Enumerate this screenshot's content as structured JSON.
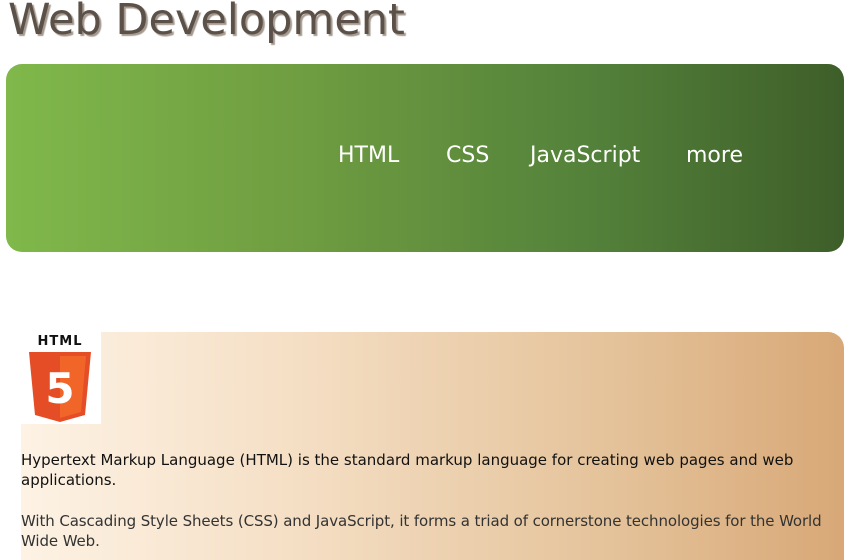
{
  "header": {
    "title": "Web Development"
  },
  "nav": {
    "items": [
      {
        "label": "HTML"
      },
      {
        "label": "CSS"
      },
      {
        "label": "JavaScript"
      },
      {
        "label": "more"
      }
    ],
    "gradient_colors": [
      "#80b84b",
      "#3e5e29"
    ]
  },
  "content": {
    "logo": {
      "text": "HTML",
      "number": "5",
      "icon": "html5-shield-icon",
      "colors": [
        "#e44d26",
        "#f16529",
        "#ebebeb",
        "#ffffff"
      ]
    },
    "paragraphs": [
      "Hypertext Markup Language (HTML) is the standard markup language for creating web pages and web applications.",
      "With Cascading Style Sheets (CSS) and JavaScript, it forms a triad of cornerstone technologies for the World Wide Web."
    ],
    "gradient_colors": [
      "#fdf2e4",
      "#d8a877"
    ]
  }
}
